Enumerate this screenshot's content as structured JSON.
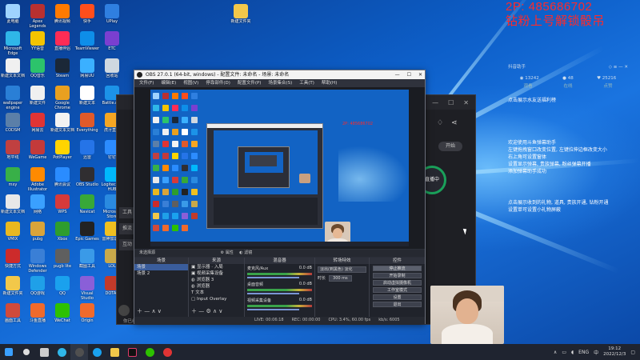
{
  "overlay": {
    "line1": "2P: 485686702",
    "line2": "钻粉上号解锁骰吊"
  },
  "desktop_icons": [
    {
      "label": "此电脑",
      "color": "#9fd3ff"
    },
    {
      "label": "Microsoft Edge",
      "color": "#2fb6e8"
    },
    {
      "label": "新建文本文档",
      "color": "#f0f0f0"
    },
    {
      "label": "wallpaper engine",
      "color": "#2a7fd6"
    },
    {
      "label": "CODSM",
      "color": "#5b7fa8"
    },
    {
      "label": "地平线",
      "color": "#c04040"
    },
    {
      "label": "mxy",
      "color": "#38b048"
    },
    {
      "label": "新建文本文档",
      "color": "#e8e8e8"
    },
    {
      "label": "VMIX",
      "color": "#e8b820"
    },
    {
      "label": "快捷方式",
      "color": "#cc2b2b"
    },
    {
      "label": "新建文件夹",
      "color": "#f2c84a"
    },
    {
      "label": "画面工具",
      "color": "#d04a3a"
    },
    {
      "label": "Apex Legends",
      "color": "#b83030"
    },
    {
      "label": "YY语音",
      "color": "#f5c400"
    },
    {
      "label": "QQ音乐",
      "color": "#2cc36b"
    },
    {
      "label": "新建文件",
      "color": "#f0f0f0"
    },
    {
      "label": "网易云",
      "color": "#e03434"
    },
    {
      "label": "WeGame",
      "color": "#c33a3a"
    },
    {
      "label": "Adobe Illustrator",
      "color": "#ff8a00"
    },
    {
      "label": "网络",
      "color": "#3aa0ff"
    },
    {
      "label": "pubg",
      "color": "#d9a43a"
    },
    {
      "label": "Windows Defender",
      "color": "#3a7fd6"
    },
    {
      "label": "QQ游戏",
      "color": "#1fa0e8"
    },
    {
      "label": "斗鱼直播",
      "color": "#f06a2b"
    },
    {
      "label": "腾讯视频",
      "color": "#ff7a00"
    },
    {
      "label": "直播伴侣",
      "color": "#fe2c55"
    },
    {
      "label": "Steam",
      "color": "#1b2838"
    },
    {
      "label": "Google Chrome",
      "color": "#e8a020"
    },
    {
      "label": "新建文本文档",
      "color": "#f2f2f2"
    },
    {
      "label": "PotPlayer",
      "color": "#ffd400"
    },
    {
      "label": "腾讯会议",
      "color": "#2a8cff"
    },
    {
      "label": "WPS",
      "color": "#d63a3a"
    },
    {
      "label": "Xbox",
      "color": "#2e9d2e"
    },
    {
      "label": "pugb lite",
      "color": "#5f5f5f"
    },
    {
      "label": "QQ",
      "color": "#1aa1ee"
    },
    {
      "label": "WeChat",
      "color": "#2dc100"
    },
    {
      "label": "快手",
      "color": "#ff4e1c"
    },
    {
      "label": "TeamViewer",
      "color": "#0e8ee9"
    },
    {
      "label": "网易UU",
      "color": "#3bb0ff"
    },
    {
      "label": "新建文本",
      "color": "#ffffff"
    },
    {
      "label": "Everything",
      "color": "#e05a2a"
    },
    {
      "label": "迅雷",
      "color": "#2574e8"
    },
    {
      "label": "OBS Studio",
      "color": "#302e31"
    },
    {
      "label": "Navicat",
      "color": "#38a838"
    },
    {
      "label": "Epic Games",
      "color": "#222222"
    },
    {
      "label": "截图工具",
      "color": "#3a9ae8"
    },
    {
      "label": "Visual Studio",
      "color": "#8a5fd8"
    },
    {
      "label": "Origin",
      "color": "#f06a2b"
    },
    {
      "label": "UPlay",
      "color": "#2f7fe0"
    },
    {
      "label": "ETC",
      "color": "#7a3fd0"
    },
    {
      "label": "回收站",
      "color": "#cfd8e0"
    },
    {
      "label": "Battle.net",
      "color": "#1c93e8"
    },
    {
      "label": "虎牙直播",
      "color": "#f5a623"
    },
    {
      "label": "钉钉",
      "color": "#2c8cff"
    },
    {
      "label": "Logitech G HUB",
      "color": "#00b8fc"
    },
    {
      "label": "Microsoft Store",
      "color": "#2a8ae0"
    },
    {
      "label": "雷神加速器",
      "color": "#f0c020"
    },
    {
      "label": "LOL",
      "color": "#c8a94a"
    },
    {
      "label": "DOTA2",
      "color": "#c23a2a"
    }
  ],
  "obs": {
    "title": "OBS 27.0.1 (64-bit, windows) - 配置文件: 未命名 - 场景: 未命名",
    "menu": [
      "文件(F)",
      "编辑(E)",
      "视图(V)",
      "停靠部件(D)",
      "配置文件(P)",
      "场景集合(S)",
      "工具(T)",
      "帮助(H)"
    ],
    "dock_label": "未选择源",
    "dock_tabs": [
      "属性",
      "滤镜"
    ],
    "scenes_header": "场景",
    "scenes": [
      "场景",
      "场景 2"
    ],
    "sources_header": "来源",
    "sources": [
      "显示器 · 入局",
      "视频采集设备",
      "浏览器 3",
      "浏览器",
      "文本",
      "Input Overlay"
    ],
    "mixer_header": "混音器",
    "mixer": [
      {
        "name": "麦克风/Aux",
        "db": "0.0 dB"
      },
      {
        "name": "桌面音频",
        "db": "0.0 dB"
      },
      {
        "name": "视频采集设备",
        "db": "0.0 dB"
      }
    ],
    "transitions_header": "转场特效",
    "transition_value": "淡出(到黑色) 淡化",
    "duration_label": "时长",
    "duration_value": "300 ms",
    "controls_header": "控件",
    "controls": [
      "停止推流",
      "开始录制",
      "启动虚拟摄像机",
      "工作室模式",
      "设置",
      "退出"
    ],
    "status": {
      "live": "LIVE: 00:06:18",
      "rec": "REC: 00:00:00",
      "cpu": "CPU: 3.4%, 60.00 fps",
      "kbps": "kb/s: 6005"
    }
  },
  "bg_app": {
    "side_tabs": [
      "工具",
      "推流",
      "互动"
    ],
    "live_label": "直播中",
    "start_label": "开始",
    "footer": "你已经开启了直播"
  },
  "side_panel": {
    "head_left": "抖音助手",
    "stats": [
      {
        "icon": "eye",
        "value": "13242"
      },
      {
        "icon": "person",
        "value": "48"
      },
      {
        "icon": "heart",
        "value": "25216"
      }
    ],
    "stat_labels": [
      "观看",
      "在线",
      "点赞"
    ],
    "lines_top": [
      "点击展示水友送福利榜"
    ],
    "lines_mid": [
      "欢迎使用斗鱼弹幕助手",
      "左键拖拽窗口改变位置, 左键拉伸边框改变大小",
      "右上角可设置窗体",
      "设置显示弹幕, 贵族弹幕, 粉丝弹幕开播",
      "添加弹幕助手成功"
    ],
    "lines_bottom": [
      "点击展示收到的礼物, 道具, 贵族开通, 钻粉开通",
      "设置单可设置小礼物屏蔽"
    ]
  },
  "taskbar": {
    "time": "19:12",
    "date": "2022/12/3",
    "lang": "ENG",
    "lang2": "中",
    "apps": [
      {
        "name": "start",
        "color": "#3aa0ff"
      },
      {
        "name": "search",
        "color": "#dddddd"
      },
      {
        "name": "task-view",
        "color": "#cccccc"
      },
      {
        "name": "edge",
        "color": "#2fb6e8"
      },
      {
        "name": "obs",
        "color": "#505050"
      },
      {
        "name": "qq",
        "color": "#1aa1ee"
      },
      {
        "name": "explorer",
        "color": "#f2c84a"
      },
      {
        "name": "douyin",
        "color": "#111111"
      },
      {
        "name": "wechat",
        "color": "#2dc100"
      },
      {
        "name": "music",
        "color": "#e03434"
      }
    ]
  },
  "colors": {
    "overlay_red": "#ff2a2a",
    "obs_bg": "#2b2e38",
    "wallpaper": "#0d5fc9"
  }
}
